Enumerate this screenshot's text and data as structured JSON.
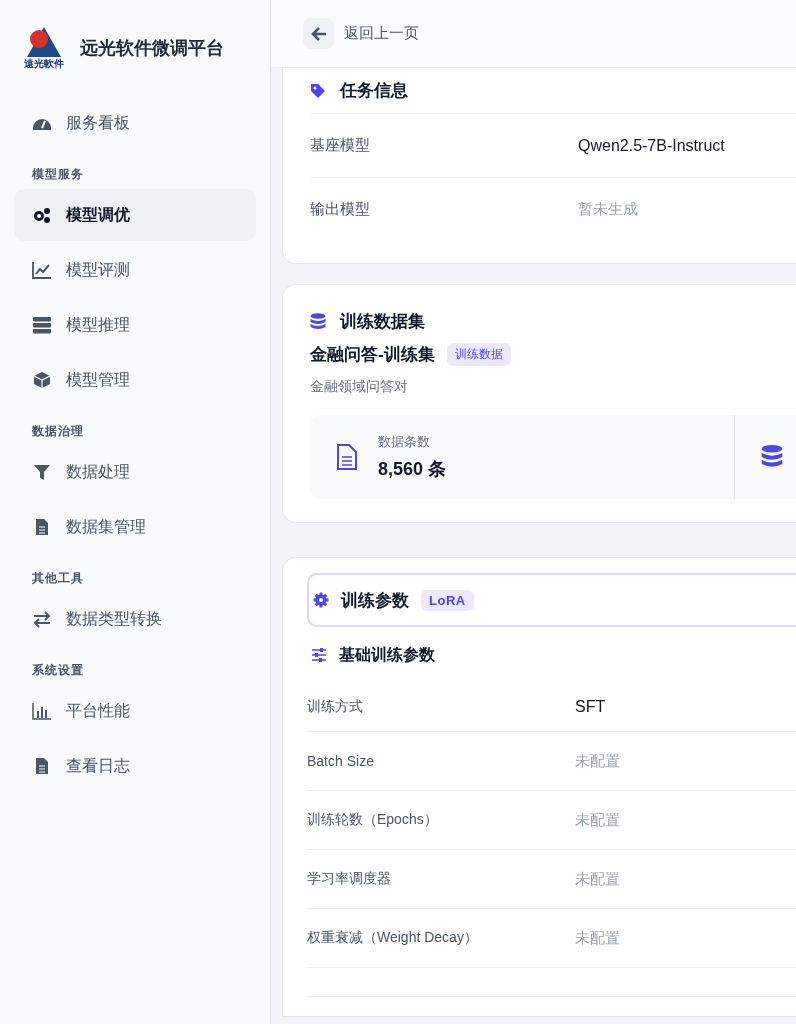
{
  "sidebar": {
    "brand": {
      "logo_text": "遠光軟件",
      "title": "远光软件微调平台"
    },
    "items": [
      {
        "kind": "link",
        "label": "服务看板",
        "selected": false
      },
      {
        "kind": "section",
        "label": "模型服务"
      },
      {
        "kind": "link",
        "label": "模型调优",
        "selected": true
      },
      {
        "kind": "link",
        "label": "模型评测",
        "selected": false
      },
      {
        "kind": "link",
        "label": "模型推理",
        "selected": false
      },
      {
        "kind": "link",
        "label": "模型管理",
        "selected": false
      },
      {
        "kind": "section",
        "label": "数据治理"
      },
      {
        "kind": "link",
        "label": "数据处理",
        "selected": false
      },
      {
        "kind": "link",
        "label": "数据集管理",
        "selected": false
      },
      {
        "kind": "section",
        "label": "其他工具"
      },
      {
        "kind": "link",
        "label": "数据类型转换",
        "selected": false
      },
      {
        "kind": "section",
        "label": "系统设置"
      },
      {
        "kind": "link",
        "label": "平台性能",
        "selected": false
      },
      {
        "kind": "link",
        "label": "查看日志",
        "selected": false
      }
    ]
  },
  "header": {
    "back_label": "返回上一页"
  },
  "task_info": {
    "title": "任务信息",
    "rows": [
      {
        "label": "基座模型",
        "value": "Qwen2.5-7B-Instruct",
        "set": true
      },
      {
        "label": "输出模型",
        "value": "暂未生成",
        "set": false
      }
    ]
  },
  "dataset": {
    "title": "训练数据集",
    "name": "金融问答-训练集",
    "tag": "训练数据",
    "description": "金融领域问答对",
    "stats": [
      {
        "label": "数据条数",
        "value": "8,560 条"
      }
    ]
  },
  "params": {
    "title": "训练参数",
    "badge": "LoRA",
    "section_title": "基础训练参数",
    "rows": [
      {
        "label": "训练方式",
        "value": "SFT",
        "set": true
      },
      {
        "label": "Batch Size",
        "value": "未配置",
        "set": false
      },
      {
        "label": "训练轮数（Epochs）",
        "value": "未配置",
        "set": false
      },
      {
        "label": "学习率调度器",
        "value": "未配置",
        "set": false
      },
      {
        "label": "权重衰减（Weight Decay）",
        "value": "未配置",
        "set": false
      }
    ]
  }
}
